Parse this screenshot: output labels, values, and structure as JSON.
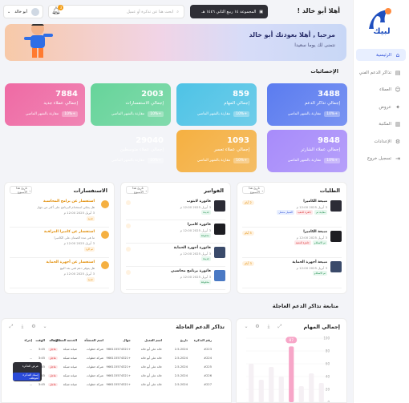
{
  "sidebar": {
    "logo_text": "لبيك",
    "items": [
      {
        "label": "الرئيسية",
        "icon": "home-icon",
        "active": true
      },
      {
        "label": "تذاكر الدعم الفني",
        "icon": "ticket-icon"
      },
      {
        "label": "العملاء",
        "icon": "users-icon"
      },
      {
        "label": "عروض",
        "icon": "offers-icon"
      },
      {
        "label": "المكتبة",
        "icon": "library-icon"
      },
      {
        "label": "الإعدادات",
        "icon": "gear-icon"
      },
      {
        "label": "تسجيل خروج",
        "icon": "logout-icon"
      }
    ]
  },
  "header": {
    "greeting": "أهلا أبو خالد !",
    "badge_text": "المجموعة ١٤ ربيع الثاني ١٤٤٦ هـ",
    "search_placeholder": "ابحث هنا عن تذكرة أو عميل",
    "notif_count": "3",
    "user_name": "أبو خالد"
  },
  "banner": {
    "title": "مرحبا , أهلا بعودتك أبو خالد",
    "subtitle": "نتمنى لك يوما سعيدا"
  },
  "stats": {
    "title": "الإحصائيات",
    "compare_label": "مقارنة بالشهر الماضي",
    "cards": [
      {
        "value": "3488",
        "label": "إجمالي تذاكر الدعم",
        "pct": "+10%",
        "color": "#5b7cf0"
      },
      {
        "value": "859",
        "label": "إجمالي المهام",
        "pct": "+10%",
        "color": "#4ec3e6"
      },
      {
        "value": "2003",
        "label": "إجمالي الاستفسارات",
        "pct": "+10%",
        "color": "#66d49a"
      },
      {
        "value": "7884",
        "label": "إجمالي عملاء جديد",
        "pct": "+10%",
        "color": "#ef6aa4"
      },
      {
        "value": "9848",
        "label": "إجمالي عملاء الشارتر",
        "pct": "+10%",
        "color": "#a78bfa"
      },
      {
        "value": "1093",
        "label": "إجمالي عملاء تعسر",
        "pct": "+10%",
        "color": "#f5b041"
      },
      {
        "value": "29040",
        "label": "إجمالي عملاء متوسطين",
        "pct": "+10%",
        "color": "#444"
      }
    ]
  },
  "requests": {
    "title": "الطلبات",
    "filter": "تاريخ هذا الأسبوع",
    "items": [
      {
        "title": "مبيعة الكاميرا",
        "meta": "3 أبريل 2025 12:00 م",
        "tags": [
          "معاينة تم",
          "جاهزة للتنفيذ",
          "العميل متصل"
        ],
        "side": "2 أيام"
      },
      {
        "title": "مبيعة الكاميرا",
        "meta": "3 أبريل 2025 12:00 م",
        "tags": [
          "تم الاستلام",
          "جاهزة للتنفيذ"
        ],
        "side": "5 أيام"
      },
      {
        "title": "مبيعة أجهزة الحماية",
        "meta": "3 أبريل 2025 12:00 م",
        "tags": [
          "تم الاستلام"
        ],
        "side": "3 أيام"
      }
    ]
  },
  "invoices": {
    "title": "الفواتير",
    "filter": "تاريخ هذا الأسبوع",
    "items": [
      {
        "title": "فاتورة لابتوب",
        "meta": "3 أبريل 2025 12:00 م",
        "tag": "جديدة"
      },
      {
        "title": "فاتورة كاميرا",
        "meta": "3 أبريل 2025 12:00 م",
        "tag": "مدفوعة"
      },
      {
        "title": "فاتورة أجهزة الحماية",
        "meta": "3 أبريل 2025 12:00 م",
        "tag": "جديدة"
      },
      {
        "title": "فاتورة برنامج محاسبي",
        "meta": "3 أبريل 2025 12:00 م",
        "tag": "مدفوعة"
      }
    ]
  },
  "inquiries": {
    "title": "الاستفسارات",
    "filter": "تاريخ هذا الأسبوع",
    "items": [
      {
        "title": "استفسار عن برامج المحاسبة",
        "desc": "هل يمكن استخدام البرنامج على أكثر من جهاز",
        "meta": "3 أبريل 2025 12:00 م",
        "tag": "جديد"
      },
      {
        "title": "استفسار عن كاميرا المراقبة",
        "desc": "ما هي مدة الضمان على الكاميرا",
        "meta": "3 أبريل 2025 12:00 م",
        "tag": "تم الرد"
      },
      {
        "title": "استفسار عن أجهزة الحماية",
        "desc": "هل يتوفر دعم فني بعد البيع",
        "meta": "3 أبريل 2025 12:00 م",
        "tag": "جديد"
      }
    ]
  },
  "followup": {
    "title": "متابعة تذاكر الدعم العاجلة",
    "chart_panel_title": "إجمالي المهام",
    "table_panel_title": "تذاكر الدعم العاجلة",
    "chart_data": {
      "type": "bar",
      "categories": [
        "1",
        "2",
        "3",
        "4",
        "5",
        "6",
        "7",
        "8"
      ],
      "values": [
        30,
        45,
        25,
        87,
        40,
        55,
        35,
        60
      ],
      "highlight_label": "87",
      "yticks": [
        "100",
        "80",
        "60",
        "40",
        "20",
        "0"
      ],
      "ylim": [
        0,
        100
      ]
    },
    "columns": [
      "رقم التذكرة",
      "تاريخ",
      "اسم العميل",
      "جوال",
      "اسم المنشأة",
      "الخدمة المطلوبة",
      "الحالة",
      "الوقت",
      "إجراء"
    ],
    "rows": [
      [
        "#223",
        "2-5-2024",
        "خالد علي أبو خالد",
        "+966115574321",
        "شركة خطوات",
        "صيانة شبكة",
        "عاجل",
        "3:45",
        "..."
      ],
      [
        "#224",
        "2-5-2024",
        "خالد علي أبو خالد",
        "+966115574321",
        "شركة خطوات",
        "صيانة شبكة",
        "عاجل",
        "3:45",
        "..."
      ],
      [
        "#225",
        "2-5-2024",
        "خالد علي أبو خالد",
        "+966115574321",
        "شركة خطوات",
        "صيانة شبكة",
        "عاجل",
        "3:45",
        "..."
      ],
      [
        "#226",
        "2-5-2024",
        "خالد علي أبو خالد",
        "+966115574321",
        "شركة خطوات",
        "صيانة شبكة",
        "عاجل",
        "3:45",
        "..."
      ],
      [
        "#227",
        "2-5-2024",
        "خالد علي أبو خالد",
        "+966115574321",
        "شركة خطوات",
        "صيانة شبكة",
        "عاجل",
        "3:45",
        "..."
      ]
    ],
    "popup": {
      "item1": "عرض التذكرة",
      "item2": "إسناد التذكرة لموظف"
    }
  }
}
